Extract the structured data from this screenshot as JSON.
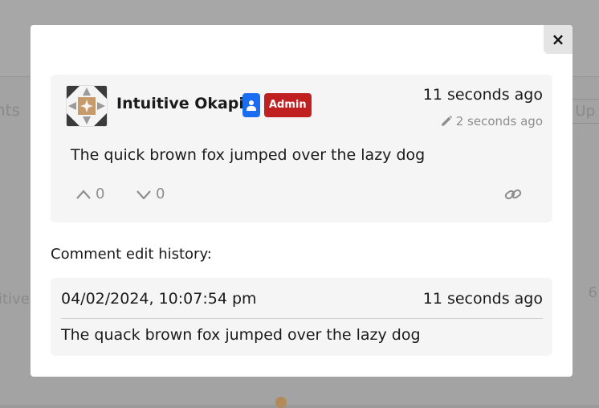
{
  "background": {
    "left_fragment_1": "nts",
    "left_fragment_2": "itive",
    "right_fragment_1": "Up",
    "right_fragment_2": "6"
  },
  "modal": {
    "close_label": "×",
    "comment": {
      "username": "Intuitive Okapi",
      "role_badge": "Admin",
      "timestamp": "11 seconds ago",
      "edited_ago": "2 seconds ago",
      "text": "The quick brown fox jumped over the lazy dog",
      "upvotes": "0",
      "downvotes": "0"
    },
    "history": {
      "label": "Comment edit history:",
      "entries": [
        {
          "date": "04/02/2024, 10:07:54 pm",
          "ago": "11 seconds ago",
          "text": "The quack brown fox jumped over the lazy dog"
        }
      ]
    }
  },
  "colors": {
    "role_icon_badge": "#1a6cf0",
    "admin_badge": "#c0201f",
    "muted_text": "#8d8d8d"
  },
  "icons": [
    "close-icon",
    "user-icon",
    "pencil-icon",
    "chevron-up-icon",
    "chevron-down-icon",
    "link-icon"
  ]
}
